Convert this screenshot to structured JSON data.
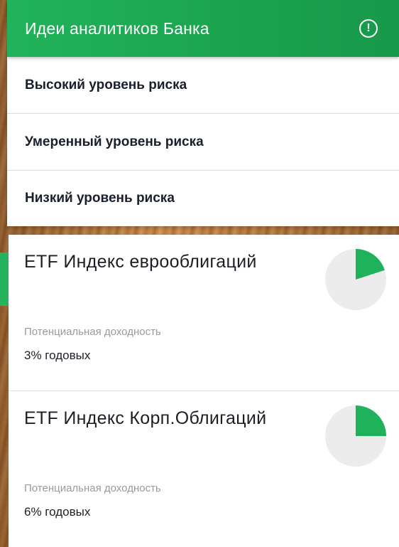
{
  "header": {
    "title": "Идеи аналитиков Банка",
    "info_icon": "info-icon"
  },
  "risk_menu": [
    {
      "label": "Высокий уровень риска"
    },
    {
      "label": "Умеренный уровень риска"
    },
    {
      "label": "Низкий уровень риска"
    }
  ],
  "funds": [
    {
      "title": "ETF Индекс еврооблигаций",
      "yield_label": "Потенциальная доходность",
      "yield_value": "3% годовых",
      "pie_fraction": 0.2
    },
    {
      "title": "ETF Индекс Корп.Облигаций",
      "yield_label": "Потенциальная доходность",
      "yield_value": "6% годовых",
      "pie_fraction": 0.25
    }
  ],
  "colors": {
    "accent": "#21b35a",
    "pie_bg": "#ececec",
    "pie_fill": "#1fb25a"
  }
}
